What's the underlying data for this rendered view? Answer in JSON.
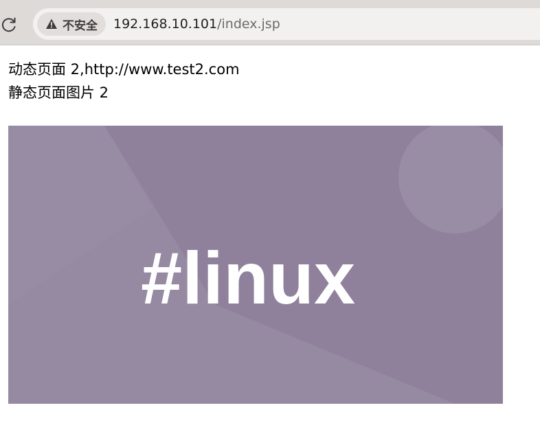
{
  "browser": {
    "security_label": "不安全",
    "url_host": "192.168.10.101",
    "url_path": "/index.jsp"
  },
  "page": {
    "line1": "动态页面 2,http://www.test2.com",
    "line2": "静态页面图片 2"
  },
  "image": {
    "text": "#linux",
    "background_color": "#8f819c",
    "text_color": "#ffffff"
  },
  "icons": {
    "reload": "reload-icon",
    "warning": "warning-triangle-icon"
  }
}
